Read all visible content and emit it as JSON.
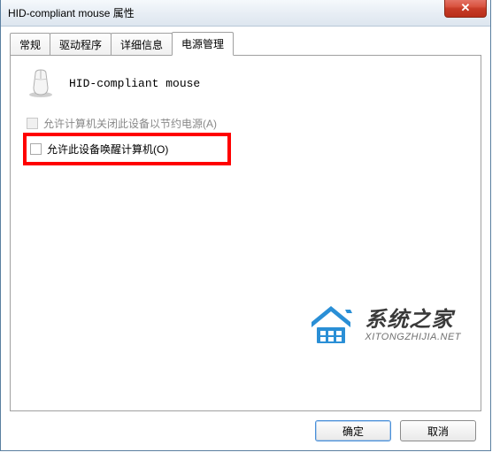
{
  "window": {
    "title": "HID-compliant mouse 属性",
    "close_glyph": "✕"
  },
  "tabs": {
    "general": "常规",
    "driver": "驱动程序",
    "details": "详细信息",
    "power": "电源管理"
  },
  "device": {
    "name": "HID-compliant mouse"
  },
  "options": {
    "allow_off_label": "允许计算机关闭此设备以节约电源(A)",
    "allow_wake_label": "允许此设备唤醒计算机(O)"
  },
  "buttons": {
    "ok": "确定",
    "cancel": "取消"
  },
  "watermark": {
    "cn": "系统之家",
    "en": "XITONGZHIJIA.NET"
  }
}
